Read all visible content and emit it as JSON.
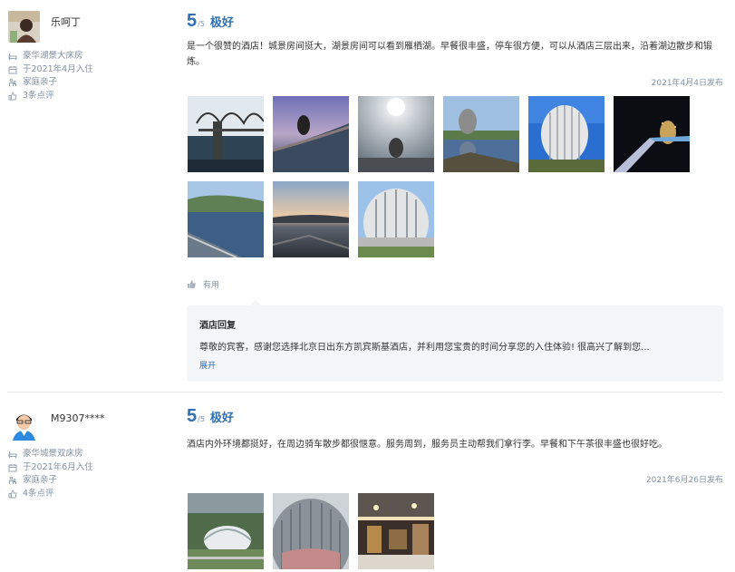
{
  "reviews": [
    {
      "user": {
        "name": "乐呵丁"
      },
      "meta": {
        "room": "豪华湖景大床房",
        "stay": "于2021年4月入住",
        "trip": "家庭亲子",
        "count": "3条点评"
      },
      "score": "5",
      "score_denominator": "/5",
      "score_label": "极好",
      "text": "是一个很赞的酒店！城景房间挺大，湖景房间可以看到雁栖湖。早餐很丰盛，停车很方便，可以从酒店三层出来，沿着湖边散步和锻炼。",
      "date": "2021年4月4日发布",
      "useful": "有用",
      "reply": {
        "title": "酒店回复",
        "text": "尊敬的宾客，感谢您选择北京日出东方凯宾斯基酒店，并利用您宝贵的时间分享您的入住体验! 很高兴了解到您...",
        "expand": "展开"
      }
    },
    {
      "user": {
        "name": "M9307****"
      },
      "meta": {
        "room": "豪华城景双床房",
        "stay": "于2021年6月入住",
        "trip": "家庭亲子",
        "count": "4条点评"
      },
      "score": "5",
      "score_denominator": "/5",
      "score_label": "极好",
      "text": "酒店内外环境都挺好，在周边骑车散步都很惬意。服务周到，服务员主动帮我们拿行李。早餐和下午茶很丰盛也很好吃。",
      "date": "2021年6月26日发布"
    }
  ],
  "colors": {
    "accent": "#2f6fb3",
    "muted": "#8592a6",
    "reply_bg": "#f5f6f8"
  },
  "icons": [
    "bed-icon",
    "calendar-icon",
    "family-icon",
    "thumbs-up-icon"
  ]
}
